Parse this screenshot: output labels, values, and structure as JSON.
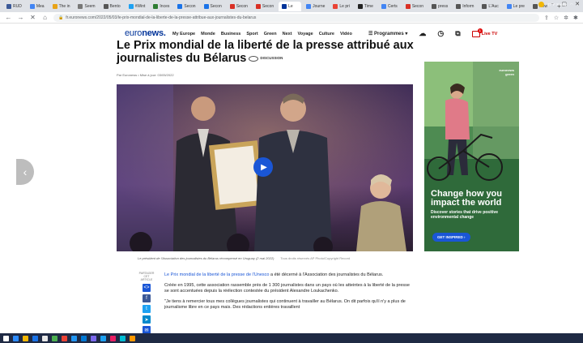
{
  "browser": {
    "tabs": [
      {
        "label": "RUD",
        "color": "#3b5998"
      },
      {
        "label": "Mea",
        "color": "#4285f4"
      },
      {
        "label": "The in",
        "color": "#e8a317"
      },
      {
        "label": "Seem",
        "color": "#777777"
      },
      {
        "label": "Bento",
        "color": "#555555"
      },
      {
        "label": "#Wint",
        "color": "#1da1f2"
      },
      {
        "label": "Inces",
        "color": "#2e7d32"
      },
      {
        "label": "Secon",
        "color": "#1a73e8"
      },
      {
        "label": "Secon",
        "color": "#1a73e8"
      },
      {
        "label": "Secon",
        "color": "#d93025"
      },
      {
        "label": "Secon",
        "color": "#d93025"
      },
      {
        "label": "Le",
        "color": "#003399",
        "active": true
      },
      {
        "label": "Journe",
        "color": "#4285f4"
      },
      {
        "label": "Le pri",
        "color": "#ea4335"
      },
      {
        "label": "Time",
        "color": "#222222"
      },
      {
        "label": "Certs",
        "color": "#4285f4"
      },
      {
        "label": "Secon",
        "color": "#d93025"
      },
      {
        "label": "press",
        "color": "#555555"
      },
      {
        "label": "Inform",
        "color": "#555555"
      },
      {
        "label": "L'Auc",
        "color": "#555555"
      },
      {
        "label": "Le pre",
        "color": "#4285f4"
      },
      {
        "label": "New",
        "color": "#555555"
      }
    ],
    "new_tab": "+",
    "url": "fr.euronews.com/2022/05/03/le-prix-mondial-de-la-liberte-de-la-presse-attribue-aux-journalistes-du-belarus"
  },
  "site": {
    "logo_light": "euro",
    "logo_bold": "news.",
    "nav": [
      "My Europe",
      "Monde",
      "Business",
      "Sport",
      "Green",
      "Next",
      "Voyage",
      "Culture",
      "Vidéo"
    ],
    "programmes": "Programmes",
    "live_tv": "Live TV",
    "notif_count": "1"
  },
  "article": {
    "headline": "Le Prix mondial de la liberté de la presse attribué aux journalistes du Bélarus",
    "discussion": "DISCUSSION",
    "byline": "Par Euronews • Mise à jour: 03/05/2022",
    "caption": "Le président de l'Association des journalistes du Bélarus récompensé en Uruguay (2 mai 2022)",
    "caption_credit": "Tous droits réservés AP Photo/Copyright Record",
    "share_label": "PARTAGER CET ARTICLE",
    "p1_link": "Le Prix mondial de la liberté de la presse de l'Unesco",
    "p1_rest": " a été décerné à l'Association des journalistes du Bélarus.",
    "p2": "Créée en 1995, cette association rassemble près de 1 300 journalistes dans un pays où les atteintes à la liberté de la presse se sont accentuées depuis la réélection contestée du président Alexandre Loukachenko.",
    "p3": "\"Je tiens à remercier tous mes collègues journalistes qui continuent à travailler au Bélarus. On dit parfois qu'il n'y a plus de journalisme libre en ce pays mais. Des rédactions entières travaillent"
  },
  "ad": {
    "logo_line1": "euronews",
    "logo_line2": "green",
    "headline": "Change how you impact the world",
    "subline": "Discover stories that drive positive environmental change",
    "cta": "GET INSPIRED ›"
  },
  "taskbar": {
    "weather": "77°F Sunny",
    "icon_colors": [
      "#ffffff",
      "#2d8cff",
      "#f2b705",
      "#1a73e8",
      "#e8e8e8",
      "#4caf50",
      "#ea4335",
      "#2196f3",
      "#0078d4",
      "#7b68ee",
      "#1da1f2",
      "#e91e63",
      "#00bcd4",
      "#ff9800"
    ]
  }
}
